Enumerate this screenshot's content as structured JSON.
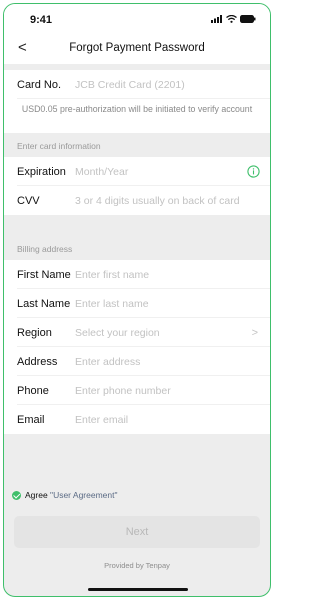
{
  "status_bar": {
    "time": "9:41",
    "icons": [
      "signal-icon",
      "wifi-icon",
      "battery-icon"
    ]
  },
  "nav": {
    "back_glyph": "<",
    "title": "Forgot Payment Password"
  },
  "card": {
    "label": "Card No.",
    "value": "JCB Credit Card (2201)"
  },
  "preauth_note": "USD0.05 pre-authorization will be initiated to verify account",
  "card_info": {
    "section_label": "Enter card information",
    "expiration": {
      "label": "Expiration",
      "placeholder": "Month/Year",
      "icon": "info-circle-icon"
    },
    "cvv": {
      "label": "CVV",
      "placeholder": "3 or 4 digits usually on back of card"
    }
  },
  "billing": {
    "section_label": "Billing address",
    "fields": [
      {
        "label": "First Name",
        "placeholder": "Enter first name"
      },
      {
        "label": "Last Name",
        "placeholder": "Enter last name"
      },
      {
        "label": "Region",
        "placeholder": "Select your region",
        "chevron": ">"
      },
      {
        "label": "Address",
        "placeholder": "Enter address"
      },
      {
        "label": "Phone",
        "placeholder": "Enter phone number"
      },
      {
        "label": "Email",
        "placeholder": "Enter email"
      }
    ]
  },
  "agreement": {
    "prefix": "Agree ",
    "link": "\"User Agreement\"",
    "checked": true
  },
  "next_button": "Next",
  "provided_by": "Provided by Tenpay",
  "colors": {
    "accent": "#3fbf6b",
    "placeholder": "#c2c2c2",
    "background": "#ededed"
  }
}
